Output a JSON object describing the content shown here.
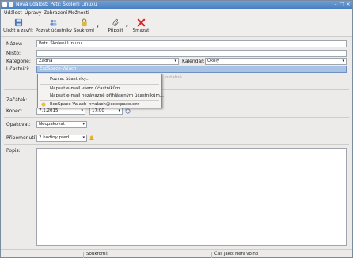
{
  "window": {
    "title": "Nová událost: Petr: Školení Linuxu"
  },
  "menu": [
    "Událost",
    "Úpravy",
    "Zobrazení",
    "Možnosti"
  ],
  "toolbar": {
    "save_close": "Uložit a zavřít",
    "invite": "Pozvat účastníky",
    "private": "Soukromí",
    "attach": "Připojit",
    "delete": "Smazat"
  },
  "form": {
    "name_label": "Název:",
    "name_value": "Petr: Školení Linuxu",
    "place_label": "Místo:",
    "place_value": "",
    "category_label": "Kategorie:",
    "category_value": "Žádná",
    "calendar_label": "Kalendář:",
    "calendar_value": "Úkoly",
    "attendees_label": "Účastníci:",
    "attendee_value": "ExoSpace-Valach",
    "start_label": "Začátek:",
    "end_label": "Konec:",
    "end_date": "7.1.2015",
    "end_time": "17:00",
    "repeat_label": "Opakovat:",
    "repeat_value": "Neopakovat",
    "reminder_label": "Připomenutí:",
    "reminder_value": "2 hodiny před",
    "desc_label": "Popis:",
    "hidden_partial": "ostatné"
  },
  "popup": {
    "invite": "Pozvat účastníky...",
    "email_all": "Napsat e-mail všem účastníkům...",
    "email_pending": "Napsat e-mail nezávazně přihlášeným účastníkům...",
    "attendee_entry": "ExoSpace-Valach <valach@exospace.cz>"
  },
  "status": {
    "privacy_label": "Soukromí:",
    "privacy_value": "",
    "time_as_label": "Čas jako:",
    "time_as_value": "Není volno"
  },
  "colors": {
    "titlebar": "#5b8fcc",
    "selection": "#a8c3e4",
    "delete_red": "#d42a2a"
  }
}
